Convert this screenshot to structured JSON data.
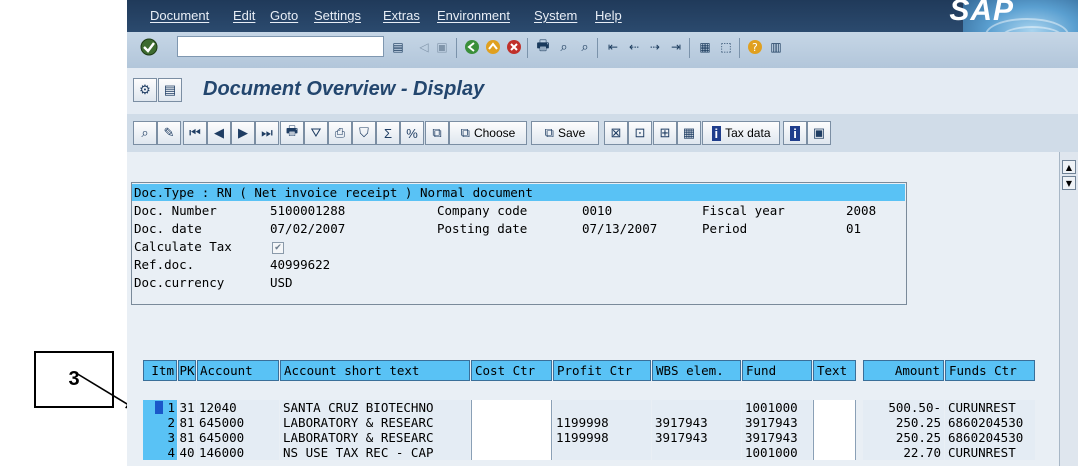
{
  "callout": {
    "label": "3"
  },
  "menu": [
    "Document",
    "Edit",
    "Goto",
    "Settings",
    "Extras",
    "Environment",
    "System",
    "Help"
  ],
  "brand": {
    "logo": "SAP"
  },
  "title": "Document Overview - Display",
  "toolbar": {
    "choose_label": "Choose",
    "save_label": "Save",
    "taxdata_label": "Tax data"
  },
  "header": {
    "doc_type_line": "Doc.Type : RN ( Net invoice receipt ) Normal document",
    "doc_number_label": "Doc. Number",
    "doc_number": "5100001288",
    "company_code_label": "Company code",
    "company_code": "0010",
    "fiscal_year_label": "Fiscal year",
    "fiscal_year": "2008",
    "doc_date_label": "Doc. date",
    "doc_date": "07/02/2007",
    "posting_date_label": "Posting date",
    "posting_date": "07/13/2007",
    "period_label": "Period",
    "period": "01",
    "calc_tax_label": "Calculate Tax",
    "calc_tax_checked": true,
    "ref_doc_label": "Ref.doc.",
    "ref_doc": "40999622",
    "currency_label": "Doc.currency",
    "currency": "USD"
  },
  "table": {
    "columns": [
      "Itm",
      "PK",
      "Account",
      "Account short text",
      "Cost Ctr",
      "Profit Ctr",
      "WBS elem.",
      "Fund",
      "Text",
      "Amount",
      "Funds Ctr"
    ],
    "rows": [
      [
        "1",
        "31",
        "12040",
        "SANTA CRUZ BIOTECHNO",
        "",
        "",
        "",
        "1001000",
        "",
        "500.50-",
        "CURUNREST"
      ],
      [
        "2",
        "81",
        "645000",
        "LABORATORY & RESEARC",
        "",
        "1199998",
        "3917943",
        "3917943",
        "",
        "250.25",
        "6860204530"
      ],
      [
        "3",
        "81",
        "645000",
        "LABORATORY & RESEARC",
        "",
        "1199998",
        "3917943",
        "3917943",
        "",
        "250.25",
        "6860204530"
      ],
      [
        "4",
        "40",
        "146000",
        "NS USE TAX REC - CAP",
        "",
        "",
        "",
        "1001000",
        "",
        "22.70",
        "CURUNREST"
      ]
    ]
  }
}
